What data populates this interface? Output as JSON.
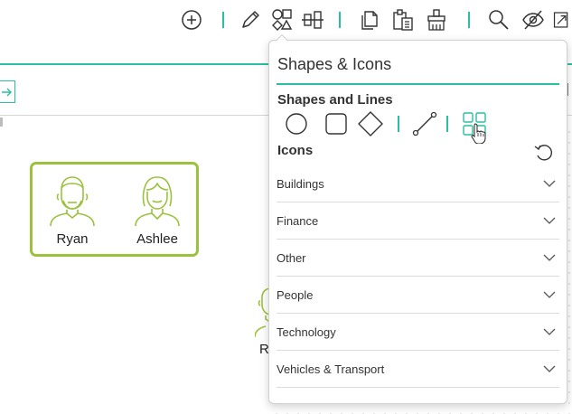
{
  "toolbar": {
    "buttons": [
      {
        "icon": "add-circle-icon"
      },
      {
        "icon": "pencil-icon"
      },
      {
        "icon": "shapes-icon"
      },
      {
        "icon": "align-icon"
      },
      {
        "icon": "copy-icon"
      },
      {
        "icon": "paste-icon"
      },
      {
        "icon": "format-painter-icon"
      },
      {
        "icon": "search-icon"
      },
      {
        "icon": "hide-icon"
      },
      {
        "icon": "export-icon"
      }
    ],
    "accent": "#2bbf9f"
  },
  "canvas": {
    "group_border_color": "#9ac23c",
    "people": [
      {
        "name": "Ryan"
      },
      {
        "name": "Ashlee"
      }
    ],
    "partial_label": "R"
  },
  "popup": {
    "title": "Shapes & Icons",
    "shapes_section": "Shapes and Lines",
    "shapes": [
      {
        "icon": "circle-shape-icon"
      },
      {
        "icon": "square-shape-icon"
      },
      {
        "icon": "diamond-shape-icon"
      },
      {
        "icon": "line-connector-icon"
      },
      {
        "icon": "icon-grid-icon"
      }
    ],
    "icons_section": "Icons",
    "categories": [
      {
        "label": "Buildings"
      },
      {
        "label": "Finance"
      },
      {
        "label": "Other"
      },
      {
        "label": "People"
      },
      {
        "label": "Technology"
      },
      {
        "label": "Vehicles & Transport"
      }
    ]
  }
}
